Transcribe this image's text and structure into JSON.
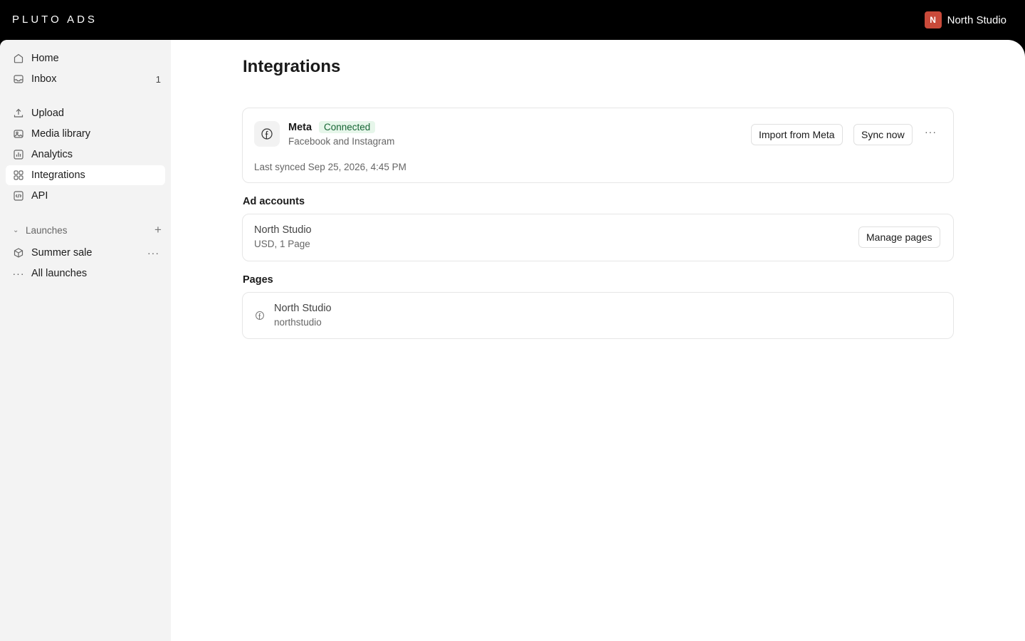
{
  "app": {
    "logo": "PLUTO ADS",
    "workspace_initial": "N",
    "workspace_name": "North Studio"
  },
  "sidebar": {
    "items": [
      {
        "label": "Home",
        "icon": "home-icon"
      },
      {
        "label": "Inbox",
        "icon": "inbox-icon",
        "count": "1"
      },
      {
        "label": "Upload",
        "icon": "upload-icon"
      },
      {
        "label": "Media library",
        "icon": "media-library-icon"
      },
      {
        "label": "Analytics",
        "icon": "analytics-icon"
      },
      {
        "label": "Integrations",
        "icon": "integrations-icon",
        "active": true
      },
      {
        "label": "API",
        "icon": "api-icon"
      }
    ],
    "launches_section": {
      "label": "Launches",
      "items": [
        {
          "label": "Summer sale",
          "icon": "box-icon"
        },
        {
          "label": "All launches",
          "icon": "ellipsis-icon"
        }
      ]
    }
  },
  "main": {
    "title": "Integrations",
    "meta_card": {
      "name": "Meta",
      "status": "Connected",
      "subtitle": "Facebook and Instagram",
      "last_synced": "Last synced Sep 25, 2026, 4:45 PM",
      "import_label": "Import from Meta",
      "sync_label": "Sync now",
      "more_label": "···"
    },
    "ad_accounts": {
      "title": "Ad accounts",
      "name": "North Studio",
      "details": "USD, 1 Page",
      "manage_label": "Manage pages"
    },
    "pages": {
      "title": "Pages",
      "name": "North Studio",
      "handle": "northstudio"
    }
  },
  "colors": {
    "topbar": "#000000",
    "sidebar_bg": "#f3f3f3",
    "avatar": "#c94a3a",
    "badge_bg": "#e6f6ea",
    "badge_text": "#166534"
  }
}
